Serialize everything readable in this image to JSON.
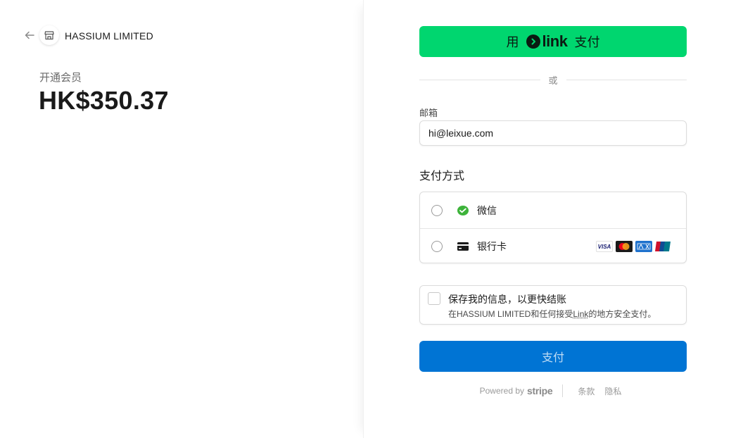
{
  "merchant": {
    "name": "HASSIUM LIMITED"
  },
  "order": {
    "product": "开通会员",
    "price": "HK$350.37"
  },
  "link_button": {
    "prefix": "用",
    "brand": "link",
    "suffix": "支付",
    "color": "#00d66f"
  },
  "divider": {
    "or": "或"
  },
  "email": {
    "label": "邮箱",
    "value": "hi@leixue.com"
  },
  "payment_methods": {
    "heading": "支付方式",
    "items": [
      {
        "label": "微信",
        "icon": "wechat-icon"
      },
      {
        "label": "银行卡",
        "icon": "card-icon",
        "brands": [
          "VISA",
          "Mastercard",
          "American Express",
          "UnionPay"
        ]
      }
    ]
  },
  "save_info": {
    "title": "保存我的信息，以更快结账",
    "desc_prefix": "在HASSIUM LIMITED和任何接受",
    "desc_link": "Link",
    "desc_suffix": "的地方安全支付。"
  },
  "pay_button": {
    "label": "支付",
    "color": "#0074d4"
  },
  "footer": {
    "powered_by": "Powered by",
    "brand": "stripe",
    "terms": "条款",
    "privacy": "隐私"
  }
}
